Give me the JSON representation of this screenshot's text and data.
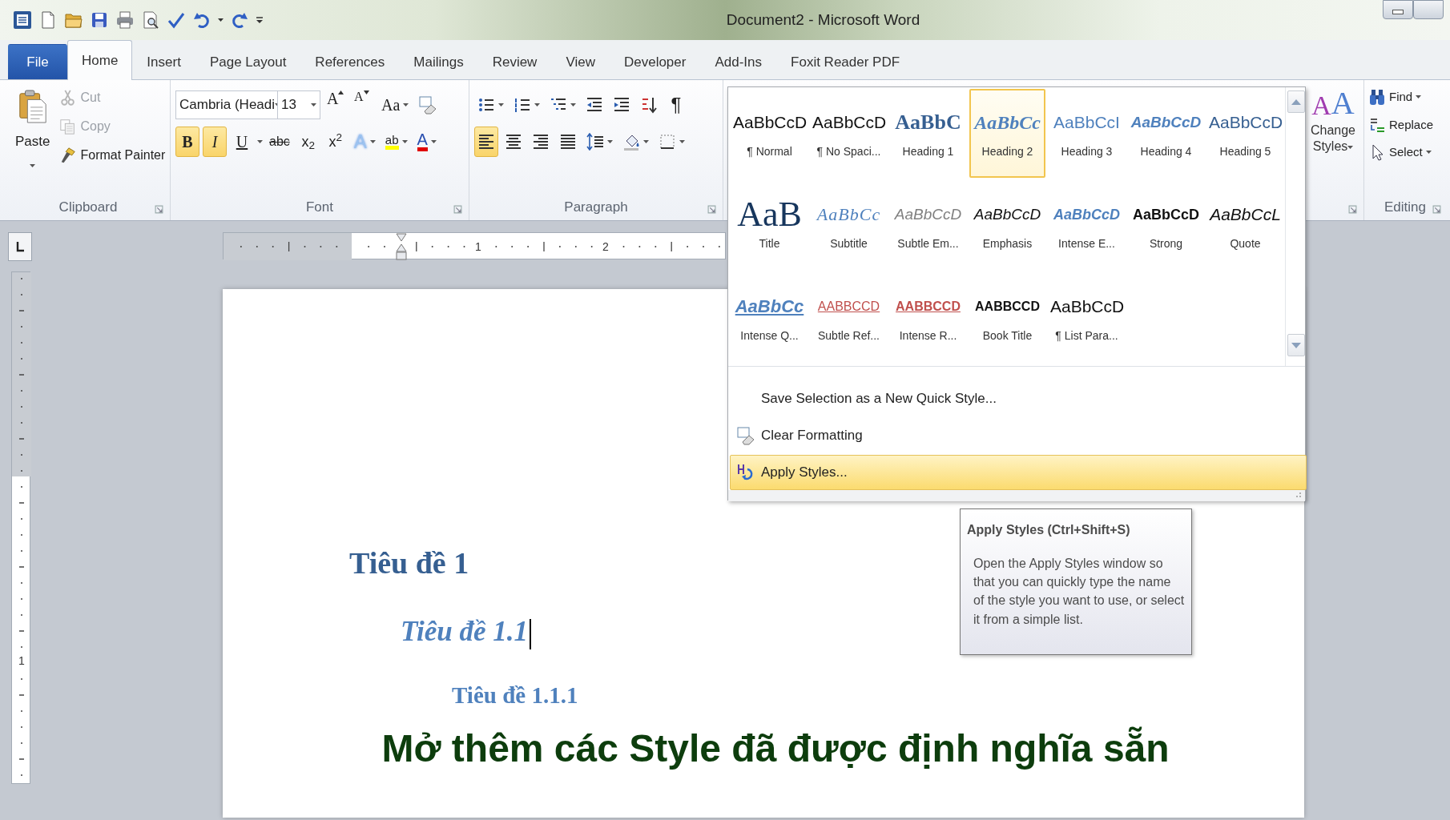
{
  "window": {
    "title": "Document2 - Microsoft Word"
  },
  "tabs": [
    {
      "label": "File",
      "kind": "file",
      "selected": false
    },
    {
      "label": "Home",
      "kind": "tab",
      "selected": true
    },
    {
      "label": "Insert",
      "kind": "tab",
      "selected": false
    },
    {
      "label": "Page Layout",
      "kind": "tab",
      "selected": false
    },
    {
      "label": "References",
      "kind": "tab",
      "selected": false
    },
    {
      "label": "Mailings",
      "kind": "tab",
      "selected": false
    },
    {
      "label": "Review",
      "kind": "tab",
      "selected": false
    },
    {
      "label": "View",
      "kind": "tab",
      "selected": false
    },
    {
      "label": "Developer",
      "kind": "tab",
      "selected": false
    },
    {
      "label": "Add-Ins",
      "kind": "tab",
      "selected": false
    },
    {
      "label": "Foxit Reader PDF",
      "kind": "tab",
      "selected": false
    }
  ],
  "clipboard": {
    "title": "Clipboard",
    "paste": "Paste",
    "items": [
      {
        "kind": "cut",
        "label": "Cut",
        "disabled": true
      },
      {
        "kind": "copy",
        "label": "Copy",
        "disabled": true
      },
      {
        "kind": "painter",
        "label": "Format Painter",
        "disabled": false
      }
    ]
  },
  "font": {
    "title": "Font",
    "name": "Cambria (Headi",
    "size": "13",
    "grow": "A",
    "shrink": "A",
    "change_case": "Aa",
    "text_effects": "A",
    "highlight": "ab",
    "font_color": "A",
    "formats": [
      {
        "kind": "bold",
        "label": "B",
        "on": true
      },
      {
        "kind": "italic",
        "label": "I",
        "on": true
      },
      {
        "kind": "underline",
        "label": "U",
        "on": false
      },
      {
        "kind": "strike",
        "label": "abc",
        "on": false
      },
      {
        "kind": "sub",
        "label": "x$_{2}$",
        "on": false
      },
      {
        "kind": "sup",
        "label": "x$^{2}$",
        "on": false
      }
    ]
  },
  "paragraph": {
    "title": "Paragraph",
    "pilcrow": "¶",
    "alignments": [
      {
        "kind": "left",
        "selected": true
      },
      {
        "kind": "center",
        "selected": false
      },
      {
        "kind": "right",
        "selected": false
      },
      {
        "kind": "justify",
        "selected": false
      }
    ]
  },
  "change_styles": {
    "letters": [
      "A",
      "A"
    ],
    "label": "Change Styles"
  },
  "editing": {
    "title": "Editing",
    "items": [
      {
        "kind": "find",
        "label": "Find",
        "dropdown": true
      },
      {
        "kind": "replace",
        "label": "Replace",
        "dropdown": false
      },
      {
        "kind": "select",
        "label": "Select",
        "dropdown": true
      }
    ]
  },
  "styles_gallery": {
    "items": [
      {
        "kind": "normal",
        "preview": "AaBbCcD",
        "name": "¶ Normal",
        "selected": false
      },
      {
        "kind": "normal",
        "preview": "AaBbCcD",
        "name": "¶ No Spaci...",
        "selected": false
      },
      {
        "kind": "heading1",
        "preview": "AaBbC",
        "name": "Heading 1",
        "selected": false
      },
      {
        "kind": "heading2",
        "preview": "AaBbCc",
        "name": "Heading 2",
        "selected": true
      },
      {
        "kind": "heading3",
        "preview": "AaBbCcI",
        "name": "Heading 3",
        "selected": false
      },
      {
        "kind": "heading4",
        "preview": "AaBbCcD",
        "name": "Heading 4",
        "selected": false
      },
      {
        "kind": "heading5",
        "preview": "AaBbCcD",
        "name": "Heading 5",
        "selected": false
      },
      {
        "kind": "title",
        "preview": "AaB",
        "name": "Title",
        "selected": false
      },
      {
        "kind": "subtitle",
        "preview": "AaBbCc",
        "name": "Subtitle",
        "selected": false
      },
      {
        "kind": "subtle_emphasis",
        "preview": "AaBbCcD",
        "name": "Subtle Em...",
        "selected": false
      },
      {
        "kind": "emphasis",
        "preview": "AaBbCcD",
        "name": "Emphasis",
        "selected": false
      },
      {
        "kind": "intense_emphasis",
        "preview": "AaBbCcD",
        "name": "Intense E...",
        "selected": false
      },
      {
        "kind": "strong",
        "preview": "AaBbCcD",
        "name": "Strong",
        "selected": false
      },
      {
        "kind": "quote",
        "preview": "AaBbCcL",
        "name": "Quote",
        "selected": false
      },
      {
        "kind": "intense_quote",
        "preview": "AaBbCc",
        "name": "Intense Q...",
        "selected": false
      },
      {
        "kind": "subtle_reference",
        "preview": "AABBCCD",
        "name": "Subtle Ref...",
        "selected": false
      },
      {
        "kind": "intense_reference",
        "preview": "AABBCCD",
        "name": "Intense R...",
        "selected": false
      },
      {
        "kind": "book_title",
        "preview": "AABBCCD",
        "name": "Book Title",
        "selected": false
      },
      {
        "kind": "normal",
        "preview": "AaBbCcD",
        "name": "¶ List Para...",
        "selected": false
      }
    ],
    "menu": [
      {
        "kind": "plain",
        "label": "Save Selection as a New Quick Style...",
        "selected": false
      },
      {
        "kind": "clear",
        "label": "Clear Formatting",
        "selected": false
      },
      {
        "kind": "apply",
        "label": "Apply Styles...",
        "selected": true
      }
    ]
  },
  "tooltip": {
    "title": "Apply Styles (Ctrl+Shift+S)",
    "body": "Open the Apply Styles window so that you can quickly type the name of the style you want to use, or select it from a simple list."
  },
  "ruler": {
    "labels": [
      "1",
      "2"
    ],
    "vertical_label": "1"
  },
  "document": {
    "paragraphs": [
      {
        "kind": "heading1",
        "text": "Tiêu đề 1",
        "cursor": false
      },
      {
        "kind": "heading2",
        "text": "Tiêu đề 1.1",
        "cursor": true
      },
      {
        "kind": "heading3",
        "text": "Tiêu đề 1.1.1",
        "cursor": false
      }
    ]
  },
  "caption": "Mở thêm các Style đã được định nghĩa sẵn"
}
